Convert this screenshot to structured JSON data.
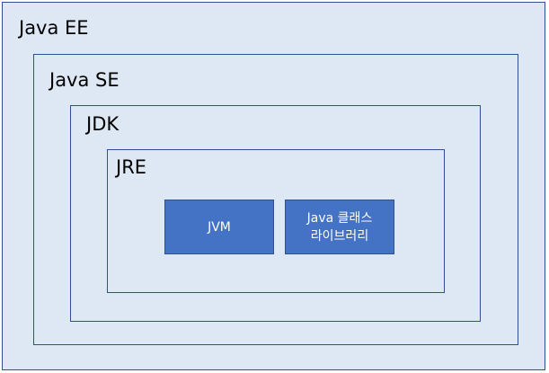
{
  "layers": {
    "java_ee": "Java EE",
    "java_se": "Java SE",
    "jdk": "JDK",
    "jre": "JRE"
  },
  "components": {
    "jvm": "JVM",
    "class_library_line1": "Java 클래스",
    "class_library_line2": "라이브러리"
  },
  "colors": {
    "container_fill": "#dee8f4",
    "container_border": "#2f528f",
    "component_fill": "#4472c4",
    "component_text": "#ffffff"
  }
}
